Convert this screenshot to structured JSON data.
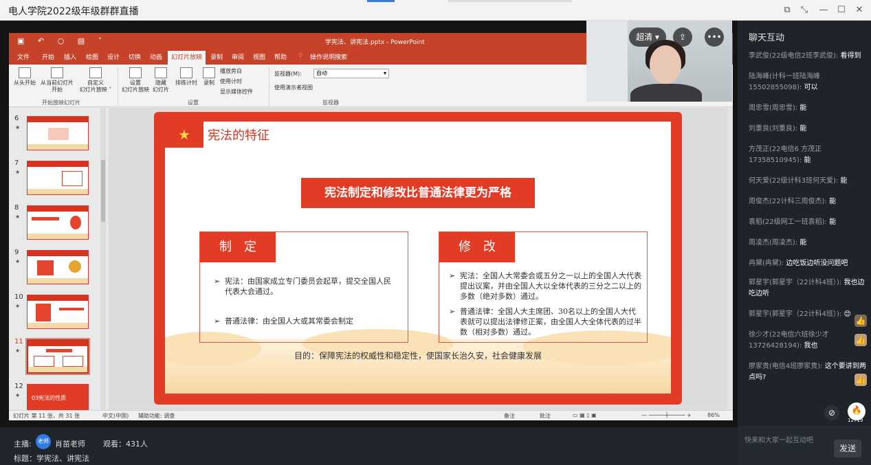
{
  "app": {
    "title": "电人学院2022级年级群群直播"
  },
  "window_controls": {
    "restore_icon": "restore-window-icon",
    "shrink_icon": "shrink-icon",
    "minimize": "—",
    "maximize": "☐",
    "close": "✕"
  },
  "ppt": {
    "window_title": "学宪法、讲宪法.pptx - PowerPoint",
    "tabs": [
      "文件",
      "开始",
      "插入",
      "绘图",
      "设计",
      "切换",
      "动画",
      "幻灯片放映",
      "录制",
      "审阅",
      "视图",
      "帮助",
      "操作说明搜索"
    ],
    "active_tab": "幻灯片放映",
    "ribbon": {
      "from_start": "从头开始",
      "from_current_line1": "从当前幻灯片",
      "from_current_line2": "开始",
      "custom_line1": "自定义",
      "custom_line2": "幻灯片放映 ˅",
      "group_start": "开始放映幻灯片",
      "setup_line1": "设置",
      "setup_line2": "幻灯片放映",
      "hide_line1": "隐藏",
      "hide_line2": "幻灯片",
      "rehearse": "排练计时",
      "record": "录制",
      "play_narrations": "播放旁白",
      "use_timings": "使用计时",
      "show_media_controls": "显示媒体控件",
      "group_setup": "设置",
      "monitor_label": "监视器(M):",
      "monitor_value": "自动",
      "presenter_view": "使用演示者视图",
      "group_monitors": "监视器"
    },
    "thumbnails": [
      {
        "num": "6",
        "star": "★"
      },
      {
        "num": "7",
        "star": "★"
      },
      {
        "num": "8",
        "star": "★"
      },
      {
        "num": "9",
        "star": "★"
      },
      {
        "num": "10",
        "star": "★"
      },
      {
        "num": "11",
        "star": "★"
      },
      {
        "num": "12",
        "star": "★"
      }
    ],
    "thumb12_text": "03宪法的性质",
    "slide": {
      "title": "宪法的特征",
      "banner": "宪法制定和修改比普通法律更为严格",
      "left_header": "制定",
      "left_item1": "宪法：由国家成立专门委员会起草，提交全国人民代表大会通过。",
      "left_item2": "普通法律：由全国人大或其常委会制定",
      "right_header": "修改",
      "right_item1": "宪法：全国人大常委会或五分之一以上的全国人大代表提出议案，并由全国人大以全体代表的三分之二以上的多数（绝对多数）通过。",
      "right_item2": "普通法律：全国人大主席团、30名以上的全国人大代表就可以提出法律修正案，由全国人大全体代表的过半数（相对多数）通过。",
      "purpose": "目的：保障宪法的权威性和稳定性，使国家长治久安，社会健康发展"
    },
    "status": {
      "slide_pos": "幻灯片 第 11 张，共 31 张",
      "lang": "中文(中国)",
      "access": "辅助功能: 调查",
      "notes": "备注",
      "comments": "批注",
      "zoom": "86%"
    }
  },
  "camera": {
    "quality_label": "超清",
    "quality_caret": "▾",
    "share_icon": "share-icon",
    "more_label": "•••"
  },
  "info": {
    "host_label": "主播:",
    "host_avatar": "老师",
    "host_name": "肖苗老师",
    "viewers": "观看：431人",
    "subject": "标题：学宪法、讲宪法"
  },
  "chat": {
    "header": "聊天互动",
    "messages": [
      {
        "user": "李武俊(22级电信2班李武俊):",
        "text": "看得到"
      },
      {
        "user": "陆海峰(计科一班陆海峰15502855098):",
        "text": "可以"
      },
      {
        "user": "周忠雪(周忠雪):",
        "text": "能"
      },
      {
        "user": "刘重良(刘重良):",
        "text": "能"
      },
      {
        "user": "方茂正(22电信6 方茂正 17358510945):",
        "text": "能"
      },
      {
        "user": "何天爱(22级计科3班何天爱):",
        "text": "能"
      },
      {
        "user": "周俊杰(22计科三周俊杰):",
        "text": "能"
      },
      {
        "user": "袁稻(22级网工一班袁稻):",
        "text": "能"
      },
      {
        "user": "周凌杰(周凌杰):",
        "text": "能"
      },
      {
        "user": "冉黛(冉黛):",
        "text": "边吃饭边听没问题吧"
      },
      {
        "user": "郭星宇(郭星宇（22计科4班）):",
        "text": "我也边吃边听"
      },
      {
        "user": "郭星宇(郭星宇（22计科4班）):",
        "text": "😊"
      },
      {
        "user": "徐少才(22电信六班徐少才13726428194):",
        "text": "我也"
      },
      {
        "user": "廖家贵(电信4班廖家贵):",
        "text": "这个要讲到两点吗?"
      }
    ],
    "badge_count": "12719",
    "placeholder": "快来和大家一起互动吧",
    "send_label": "发送"
  },
  "colors": {
    "ppt_accent": "#c6432a",
    "slide_red": "#e23b26",
    "chat_bg": "#1f232a",
    "host_avatar_blue": "#2f7be5"
  }
}
